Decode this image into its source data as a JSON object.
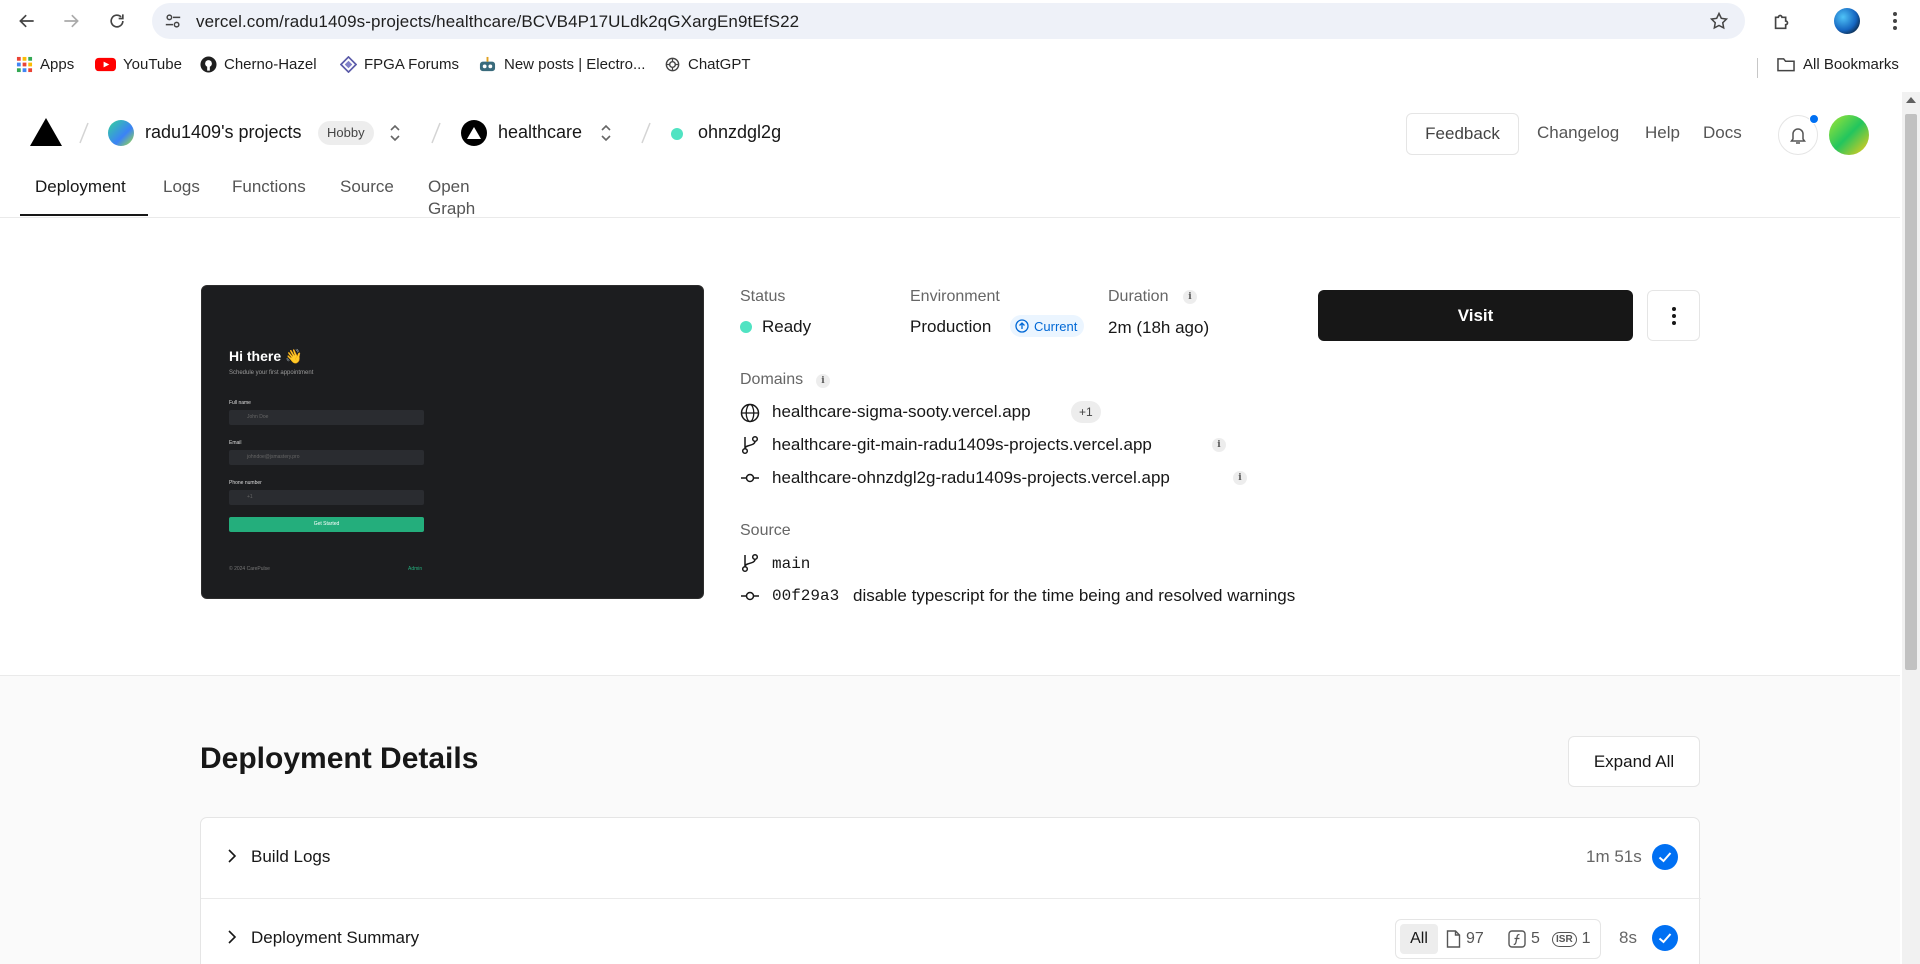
{
  "browser": {
    "url": "vercel.com/radu1409s-projects/healthcare/BCVB4P17ULdk2qGXargEn9tEfS22",
    "bookmarks": [
      {
        "label": "Apps",
        "icon": "apps-grid-icon"
      },
      {
        "label": "YouTube",
        "icon": "youtube-icon"
      },
      {
        "label": "Cherno-Hazel",
        "icon": "github-icon"
      },
      {
        "label": "FPGA Forums",
        "icon": "fpga-icon"
      },
      {
        "label": "New posts | Electro...",
        "icon": "robot-icon"
      },
      {
        "label": "ChatGPT",
        "icon": "chatgpt-icon"
      }
    ],
    "all_bookmarks": "All Bookmarks"
  },
  "header": {
    "team_name": "radu1409's projects",
    "plan_badge": "Hobby",
    "project_name": "healthcare",
    "deployment_id": "ohnzdgl2g",
    "feedback": "Feedback",
    "links": [
      "Changelog",
      "Help",
      "Docs"
    ]
  },
  "tabs": [
    "Deployment",
    "Logs",
    "Functions",
    "Source",
    "Open Graph"
  ],
  "preview": {
    "title": "Hi there 👋",
    "subtitle": "Schedule your first appointment",
    "fields": [
      {
        "label": "Full name",
        "placeholder": "John Doe"
      },
      {
        "label": "Email",
        "placeholder": "johndoe@jsmastery.pro"
      },
      {
        "label": "Phone number",
        "placeholder": "+1"
      }
    ],
    "button": "Get Started",
    "footer_left": "© 2024 CarePulse",
    "footer_right": "Admin"
  },
  "deployment": {
    "status_label": "Status",
    "status_value": "Ready",
    "environment_label": "Environment",
    "environment_value": "Production",
    "current_badge": "Current",
    "duration_label": "Duration",
    "duration_value": "2m (18h ago)",
    "visit": "Visit",
    "domains_label": "Domains",
    "domains": [
      "healthcare-sigma-sooty.vercel.app",
      "healthcare-git-main-radu1409s-projects.vercel.app",
      "healthcare-ohnzdgl2g-radu1409s-projects.vercel.app"
    ],
    "domains_extra": "+1",
    "source_label": "Source",
    "branch": "main",
    "commit_hash": "00f29a3",
    "commit_message": "disable typescript for the time being and resolved warnings"
  },
  "details": {
    "title": "Deployment Details",
    "expand_all": "Expand All",
    "build_logs": {
      "title": "Build Logs",
      "time": "1m 51s"
    },
    "summary": {
      "title": "Deployment Summary",
      "filter_all": "All",
      "static_count": "97",
      "functions_count": "5",
      "isr_label": "ISR",
      "isr_count": "1",
      "time": "8s"
    }
  },
  "colors": {
    "ready": "#50e3c2",
    "accent_blue": "#0070f3",
    "preview_green": "#24ae7c"
  }
}
